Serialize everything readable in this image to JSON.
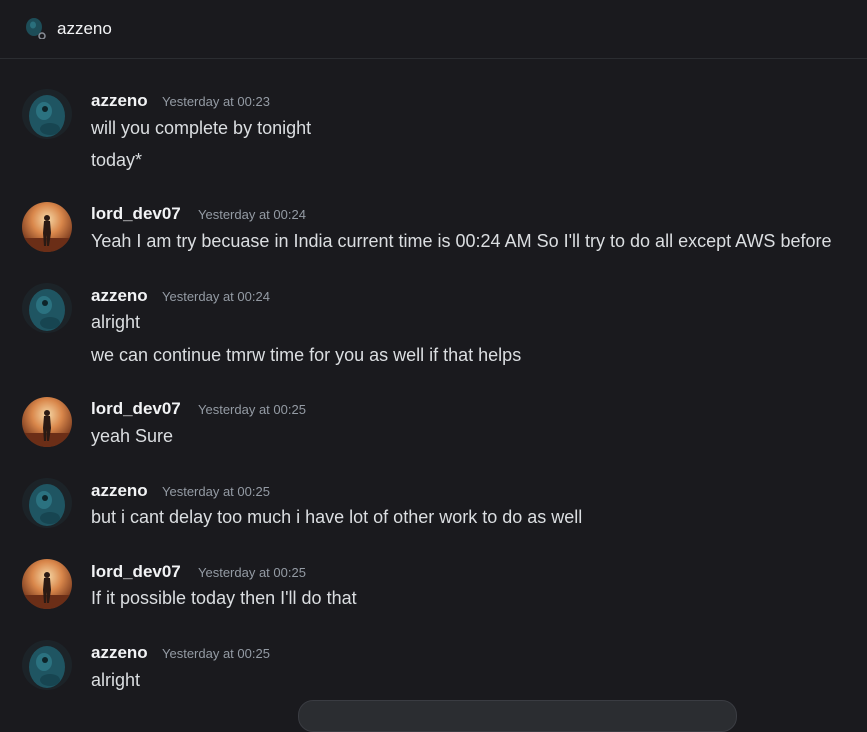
{
  "header": {
    "title": "azzeno"
  },
  "messages": [
    {
      "user": "azzeno",
      "time": "Yesterday at 00:23",
      "lines": [
        "will you complete by tonight",
        "today*"
      ]
    },
    {
      "user": "lord_dev07",
      "time": "Yesterday at 00:24",
      "lines": [
        "Yeah I am try becuase in India current time is 00:24 AM So I'll try to do all except AWS before"
      ]
    },
    {
      "user": "azzeno",
      "time": "Yesterday at 00:24",
      "lines": [
        "alright",
        "we can continue tmrw time for you as well if that helps"
      ]
    },
    {
      "user": "lord_dev07",
      "time": "Yesterday at 00:25",
      "lines": [
        "yeah Sure"
      ]
    },
    {
      "user": "azzeno",
      "time": "Yesterday at 00:25",
      "lines": [
        "but i cant delay too much i have lot of other work to do as well"
      ]
    },
    {
      "user": "lord_dev07",
      "time": "Yesterday at 00:25",
      "lines": [
        "If it possible today then I'll do that"
      ]
    },
    {
      "user": "azzeno",
      "time": "Yesterday at 00:25",
      "lines": [
        "alright"
      ]
    }
  ],
  "colors": {
    "background": "#1a1a1e",
    "username": "#f2f3f5",
    "timestamp": "#949ba4",
    "text": "#dbdee1"
  },
  "icons": {
    "azzeno_avatar": "teal-creature-avatar",
    "lord_dev07_avatar": "sunset-figure-avatar"
  }
}
